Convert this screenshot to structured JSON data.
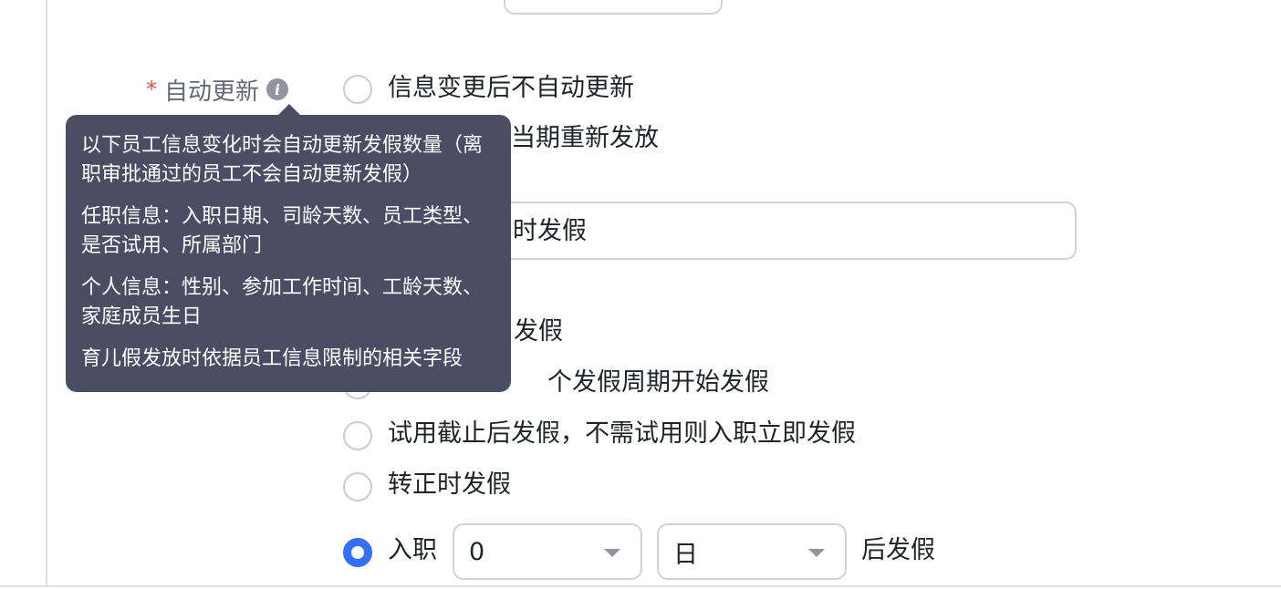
{
  "auto_update": {
    "label": "自动更新",
    "required_mark": "*",
    "info_icon": "i",
    "option_no_auto": "信息变更后不自动更新",
    "option_reissue_partial": "当期重新发放"
  },
  "tooltip": {
    "line1": "以下员工信息变化时会自动更新发假数量（离职审批通过的员工不会自动更新发假）",
    "line2": "任职信息：入职日期、司龄天数、员工类型、是否试用、所属部门",
    "line3": "个人信息：性别、参加工作时间、工龄天数、家庭成员生日",
    "line4": "育儿假发放时依据员工信息限制的相关字段"
  },
  "input_partial_text": "时发假",
  "issue_timing": {
    "option_a_partial": "发假",
    "option_b_partial": "个发假周期开始发假",
    "option_c": "试用截止后发假，不需试用则入职立即发假",
    "option_d": "转正时发假",
    "option_e_prefix": "入职",
    "option_e_number": "0",
    "option_e_unit": "日",
    "option_e_suffix": "后发假"
  },
  "colors": {
    "accent": "#3370ff",
    "tooltip_bg": "#4a4d63",
    "required": "#f54a45"
  }
}
